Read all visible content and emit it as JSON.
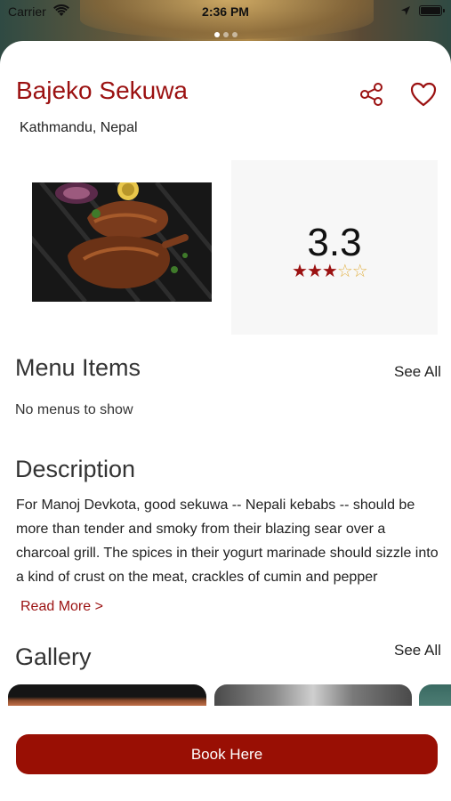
{
  "status_bar": {
    "carrier": "Carrier",
    "time": "2:36 PM"
  },
  "restaurant": {
    "name": "Bajeko Sekuwa",
    "location": "Kathmandu, Nepal"
  },
  "rating": {
    "value": "3.3",
    "stars_filled": 3,
    "stars_total": 5
  },
  "menu": {
    "heading": "Menu Items",
    "see_all": "See All",
    "empty_text": "No menus to show"
  },
  "description": {
    "heading": "Description",
    "text": "For Manoj Devkota, good sekuwa -- Nepali kebabs -- should be more than tender and smoky from their blazing sear over a charcoal grill. The spices in their yogurt marinade should sizzle into a kind of crust on the meat, crackles of cumin and pepper",
    "read_more": "Read More >"
  },
  "gallery": {
    "heading": "Gallery",
    "see_all": "See All"
  },
  "actions": {
    "book_label": "Book Here"
  },
  "colors": {
    "accent": "#9b1111",
    "button": "#990f04"
  }
}
